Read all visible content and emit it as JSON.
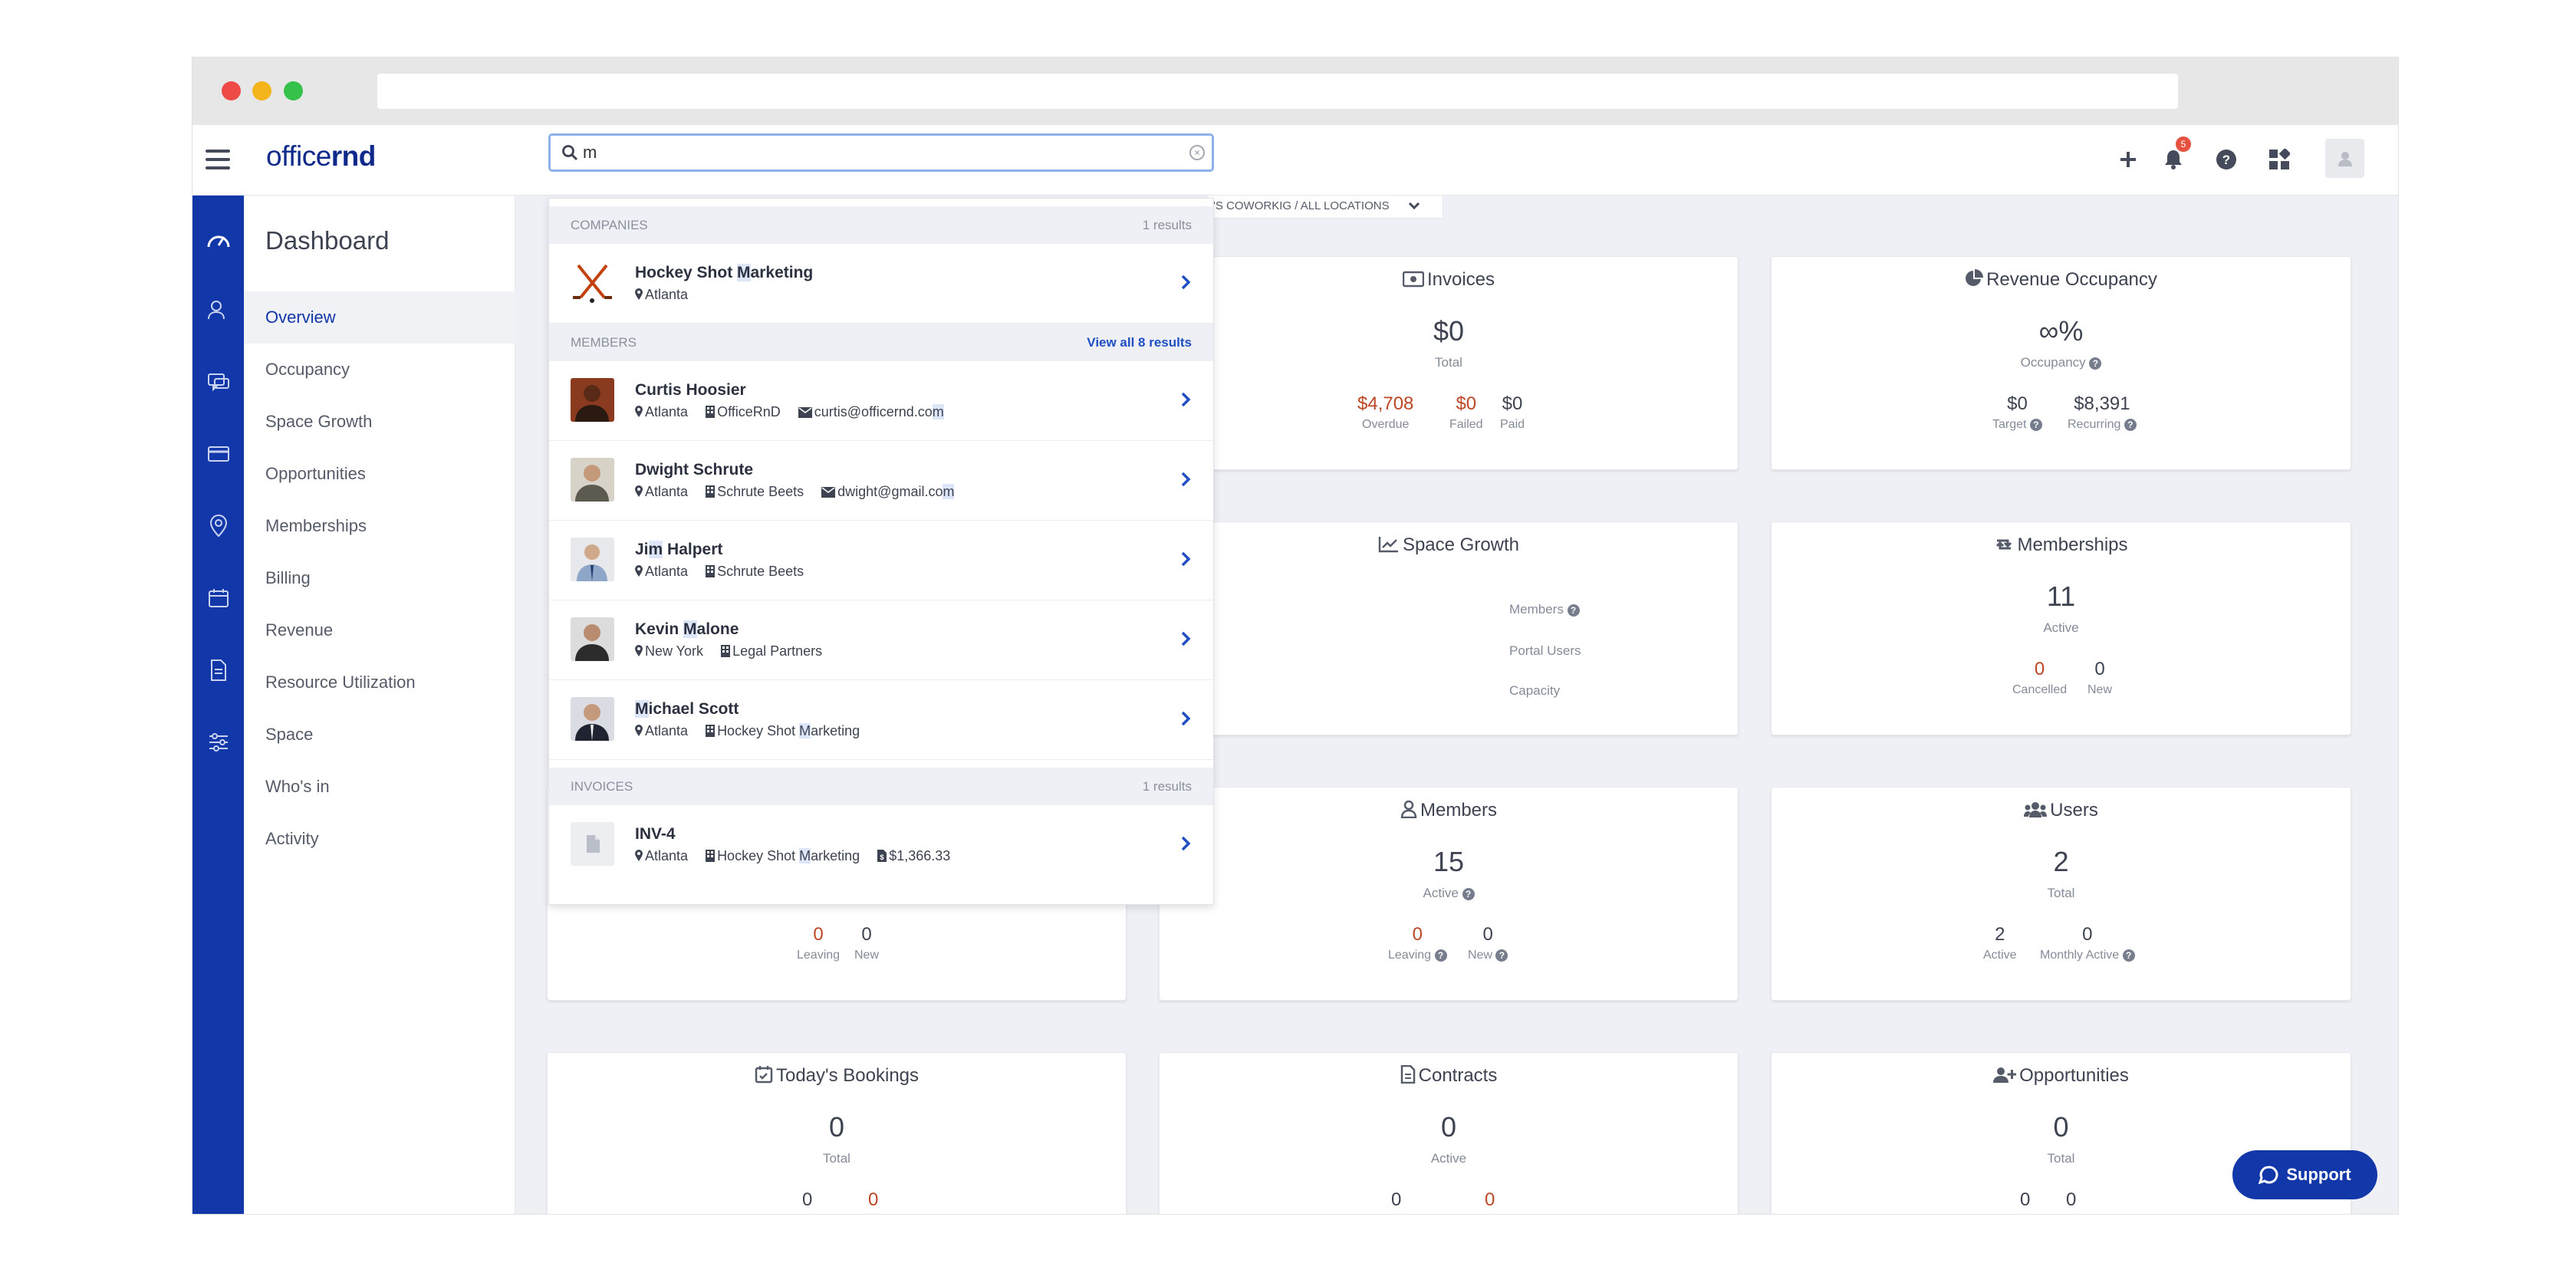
{
  "app": {
    "logo_light": "office",
    "logo_bold": "rnd"
  },
  "search": {
    "value": "m",
    "placeholder": ""
  },
  "notifications": {
    "count": "5"
  },
  "sidebar": {
    "title": "Dashboard",
    "items": [
      {
        "label": "Overview",
        "active": true
      },
      {
        "label": "Occupancy"
      },
      {
        "label": "Space Growth"
      },
      {
        "label": "Opportunities"
      },
      {
        "label": "Memberships"
      },
      {
        "label": "Billing"
      },
      {
        "label": "Revenue"
      },
      {
        "label": "Resource Utilization"
      },
      {
        "label": "Space"
      },
      {
        "label": "Who's in"
      },
      {
        "label": "Activity"
      }
    ]
  },
  "breadcrumb": {
    "text": "'S COWORKIG  /  ALL LOCATIONS"
  },
  "cards": {
    "invoices": {
      "title": "Invoices",
      "value": "$0",
      "sub": "Total",
      "stats": [
        {
          "v": "$4,708",
          "l": "Overdue"
        },
        {
          "v": "$0",
          "l": "Failed"
        },
        {
          "v": "$0",
          "l": "Paid"
        }
      ]
    },
    "revenue_occupancy": {
      "title": "Revenue Occupancy",
      "value": "∞%",
      "sub": "Occupancy",
      "stats": [
        {
          "v": "$0",
          "l": "Target"
        },
        {
          "v": "$8,391",
          "l": "Recurring"
        }
      ]
    },
    "space_growth": {
      "title": "Space Growth",
      "labels": [
        "Members",
        "Portal Users",
        "Capacity"
      ]
    },
    "memberships": {
      "title": "Memberships",
      "value": "11",
      "sub": "Active",
      "stats": [
        {
          "v": "0",
          "l": "Cancelled"
        },
        {
          "v": "0",
          "l": "New"
        }
      ]
    },
    "left_partial": {
      "stats": [
        {
          "v": "0",
          "l": "Leaving"
        },
        {
          "v": "0",
          "l": "New"
        }
      ]
    },
    "members": {
      "title": "Members",
      "value": "15",
      "sub": "Active",
      "stats": [
        {
          "v": "0",
          "l": "Leaving"
        },
        {
          "v": "0",
          "l": "New"
        }
      ]
    },
    "users": {
      "title": "Users",
      "value": "2",
      "sub": "Total",
      "stats": [
        {
          "v": "2",
          "l": "Active"
        },
        {
          "v": "0",
          "l": "Monthly Active"
        }
      ]
    },
    "bookings": {
      "title": "Today's Bookings",
      "value": "0",
      "sub": "Total",
      "stats": [
        {
          "v": "0"
        },
        {
          "v": "0"
        }
      ]
    },
    "contracts": {
      "title": "Contracts",
      "value": "0",
      "sub": "Active",
      "stats": [
        {
          "v": "0"
        },
        {
          "v": "0"
        }
      ]
    },
    "opportunities": {
      "title": "Opportunities",
      "value": "0",
      "sub": "Total",
      "stats": [
        {
          "v": "0"
        },
        {
          "v": "0"
        }
      ]
    }
  },
  "dropdown": {
    "companies": {
      "label": "COMPANIES",
      "count": "1 results"
    },
    "company": {
      "name_pre": "Hockey Shot ",
      "name_hl": "M",
      "name_post": "arketing",
      "location": "Atlanta"
    },
    "members": {
      "label": "MEMBERS",
      "link": "View all 8 results"
    },
    "member_rows": [
      {
        "name_pre": "Curtis Hoosier",
        "name_hl": "",
        "name_post": "",
        "location": "Atlanta",
        "company": "OfficeRnD",
        "email_pre": "curtis@officernd.co",
        "email_hl": "m"
      },
      {
        "name_pre": "Dwight Schrute",
        "name_hl": "",
        "name_post": "",
        "location": "Atlanta",
        "company": "Schrute Beets",
        "email_pre": "dwight@gmail.co",
        "email_hl": "m"
      },
      {
        "name_pre": "Ji",
        "name_hl": "m",
        "name_post": " Halpert",
        "location": "Atlanta",
        "company": "Schrute Beets"
      },
      {
        "name_pre": "Kevin ",
        "name_hl": "M",
        "name_post": "alone",
        "location": "New York",
        "company": "Legal Partners"
      },
      {
        "name_pre": "",
        "name_hl": "M",
        "name_post": "ichael Scott",
        "location": "Atlanta",
        "company_pre": "Hockey Shot ",
        "company_hl": "M",
        "company_post": "arketing"
      }
    ],
    "invoices": {
      "label": "INVOICES",
      "count": "1 results"
    },
    "invoice": {
      "name": "INV-4",
      "location": "Atlanta",
      "company_pre": "Hockey Shot ",
      "company_hl": "M",
      "company_post": "arketing",
      "amount": "$1,366.33"
    }
  },
  "support": {
    "label": "Support"
  },
  "colors": {
    "brand": "#1237a8",
    "danger": "#bd4625",
    "bg": "#eef0f5"
  }
}
